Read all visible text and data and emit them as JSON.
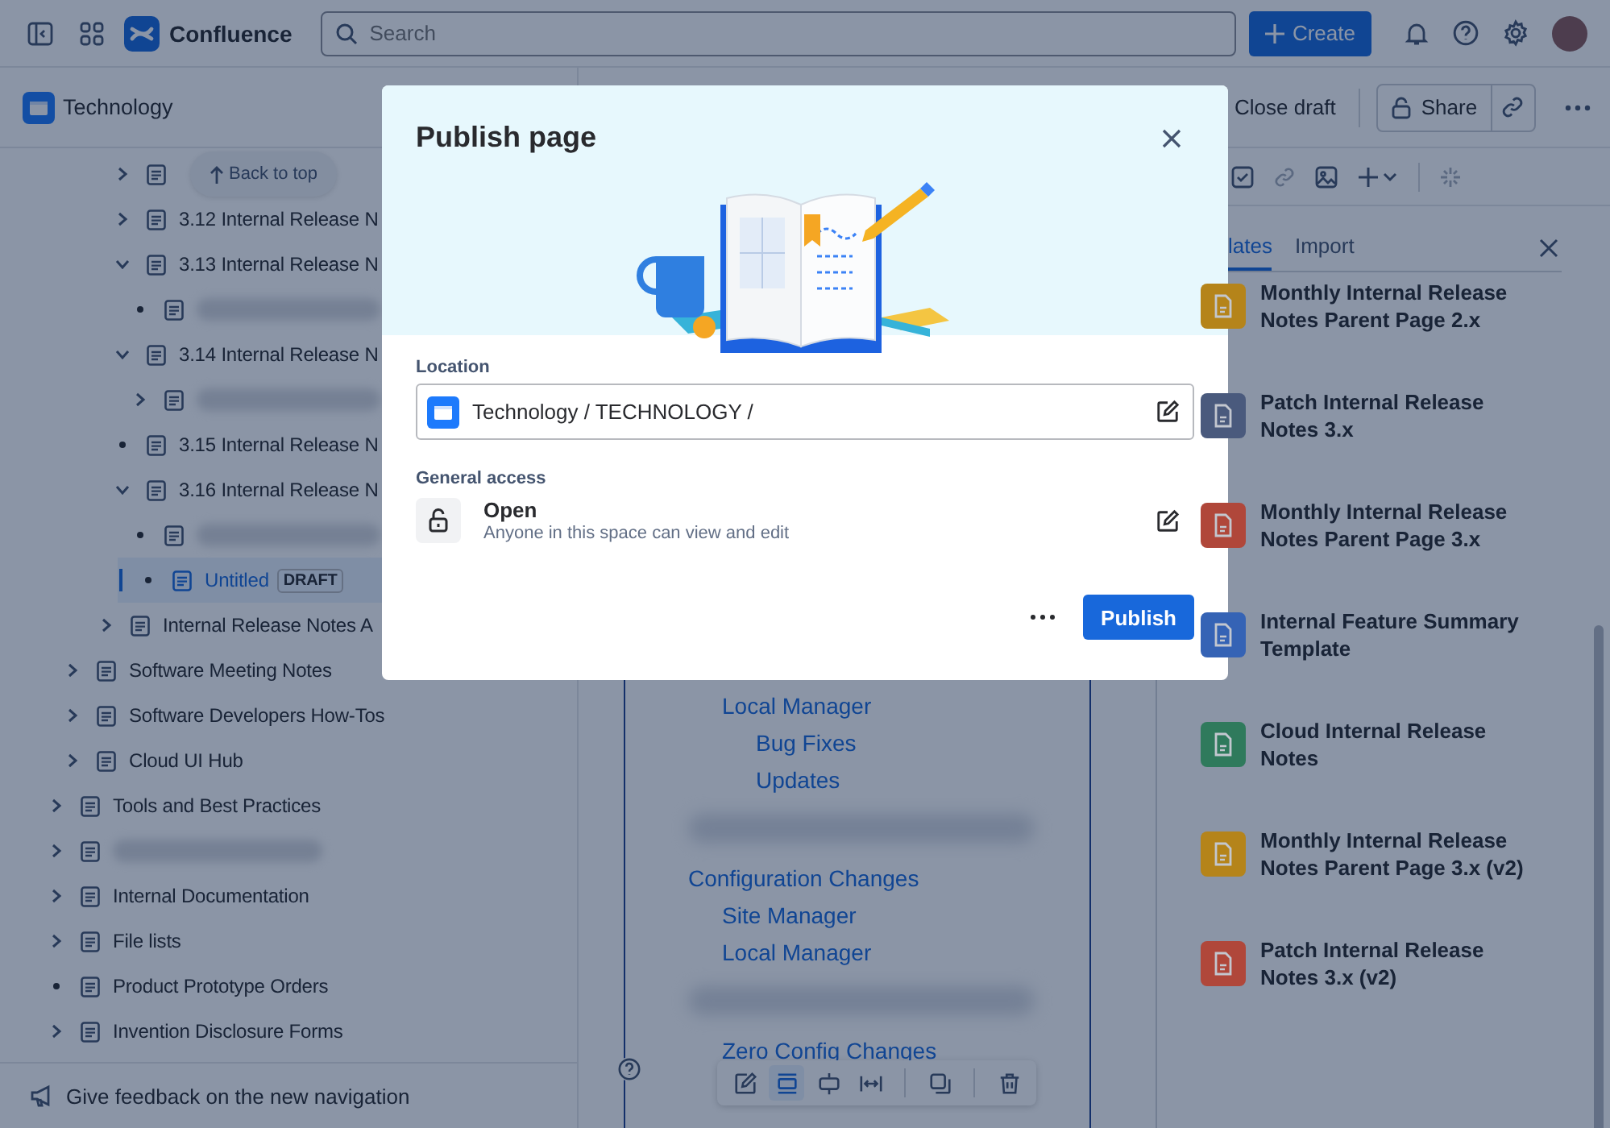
{
  "topbar": {
    "product": "Confluence",
    "search": {
      "placeholder": "Search"
    },
    "create_button": "Create"
  },
  "sidebar": {
    "space": "Technology",
    "back_to_top": "Back to top",
    "tree": [
      {
        "children": [
          {
            "children": [
              {
                "children": [
                  {
                    "kind": "branch",
                    "expanded": false,
                    "selected": false
                  },
                  {
                    "label": "3.12 Internal Release N",
                    "kind": "branch",
                    "expanded": false,
                    "selected": false
                  },
                  {
                    "label": "3.13 Internal Release N",
                    "kind": "branch",
                    "expanded": true,
                    "selected": false,
                    "children": [
                      {
                        "kind": "leaf",
                        "redacted": true,
                        "selected": false
                      }
                    ]
                  },
                  {
                    "label": "3.14 Internal Release N",
                    "kind": "branch",
                    "expanded": true,
                    "selected": false,
                    "children": [
                      {
                        "kind": "branch",
                        "expanded": false,
                        "redacted": true,
                        "selected": false
                      }
                    ]
                  },
                  {
                    "label": "3.15 Internal Release N",
                    "kind": "leaf",
                    "selected": false
                  },
                  {
                    "label": "3.16 Internal Release N",
                    "kind": "branch",
                    "expanded": true,
                    "selected": false,
                    "children": [
                      {
                        "kind": "leaf",
                        "redacted": true,
                        "selected": false
                      },
                      {
                        "label": "Untitled",
                        "badge": "DRAFT",
                        "kind": "leaf",
                        "selected": true
                      }
                    ]
                  }
                ]
              },
              {
                "label": "Internal Release Notes A",
                "kind": "branch",
                "expanded": false,
                "selected": false
              }
            ]
          },
          {
            "label": "Software Meeting Notes",
            "kind": "branch",
            "expanded": false,
            "selected": false
          },
          {
            "label": "Software Developers How-Tos",
            "kind": "branch",
            "expanded": false,
            "selected": false
          },
          {
            "label": "Cloud UI Hub",
            "kind": "branch",
            "expanded": false,
            "selected": false
          }
        ]
      },
      {
        "label": "Tools and Best Practices",
        "kind": "branch",
        "expanded": false,
        "selected": false
      },
      {
        "kind": "branch",
        "expanded": false,
        "redacted": true,
        "selected": false
      },
      {
        "label": "Internal Documentation",
        "kind": "branch",
        "expanded": false,
        "selected": false
      },
      {
        "label": "File lists",
        "kind": "branch",
        "expanded": false,
        "selected": false
      },
      {
        "label": "Product Prototype Orders",
        "kind": "leaf",
        "selected": false
      },
      {
        "label": "Invention Disclosure Forms",
        "kind": "branch",
        "expanded": false,
        "selected": false
      }
    ],
    "feedback": "Give feedback on the new navigation"
  },
  "editor_header": {
    "close_draft": "Close draft",
    "share": "Share"
  },
  "editor": {
    "outline": [
      {
        "children": [
          {
            "label": "Local Manager",
            "children": [
              {
                "label": "Bug Fixes"
              },
              {
                "label": "Updates"
              }
            ]
          }
        ]
      },
      {
        "redacted": true
      },
      {
        "label": "Configuration Changes",
        "children": [
          {
            "label": "Site Manager"
          },
          {
            "label": "Local Manager"
          }
        ]
      },
      {
        "redacted": true
      },
      {
        "children": [
          {
            "label": "Zero Config Changes"
          }
        ]
      }
    ],
    "image_toolbar": [
      {
        "kind": "edit",
        "selected": false
      },
      {
        "kind": "wrap",
        "selected": true
      },
      {
        "kind": "center",
        "selected": false
      },
      {
        "kind": "width",
        "selected": false
      },
      {
        "kind": "copy",
        "selected": false
      },
      {
        "kind": "delete",
        "selected": false
      }
    ]
  },
  "templates_panel": {
    "tabs": [
      {
        "label": "lates",
        "selected": true
      },
      {
        "label": "Import",
        "selected": false
      }
    ],
    "items": [
      {
        "title": "Monthly Internal Release Notes Parent Page 2.x",
        "color": "#b5841a"
      },
      {
        "title": "Patch Internal Release Notes 3.x",
        "color": "#4a5a7d"
      },
      {
        "title": "Monthly Internal Release Notes Parent Page 3.x",
        "color": "#b0473a"
      },
      {
        "title": "Internal Feature Summary Template",
        "color": "#3563b5"
      },
      {
        "title": "Cloud Internal Release Notes",
        "color": "#2f7a5c"
      },
      {
        "title": "Monthly Internal Release Notes Parent Page 3.x (v2)",
        "color": "#b5841a"
      },
      {
        "title": "Patch Internal Release Notes 3.x (v2)",
        "color": "#b0473a"
      }
    ]
  },
  "modal": {
    "title": "Publish page",
    "location_label": "Location",
    "location_path": "Technology / TECHNOLOGY /",
    "access_label": "General access",
    "access_title": "Open",
    "access_description": "Anyone in this space can view and edit",
    "publish_button": "Publish"
  }
}
